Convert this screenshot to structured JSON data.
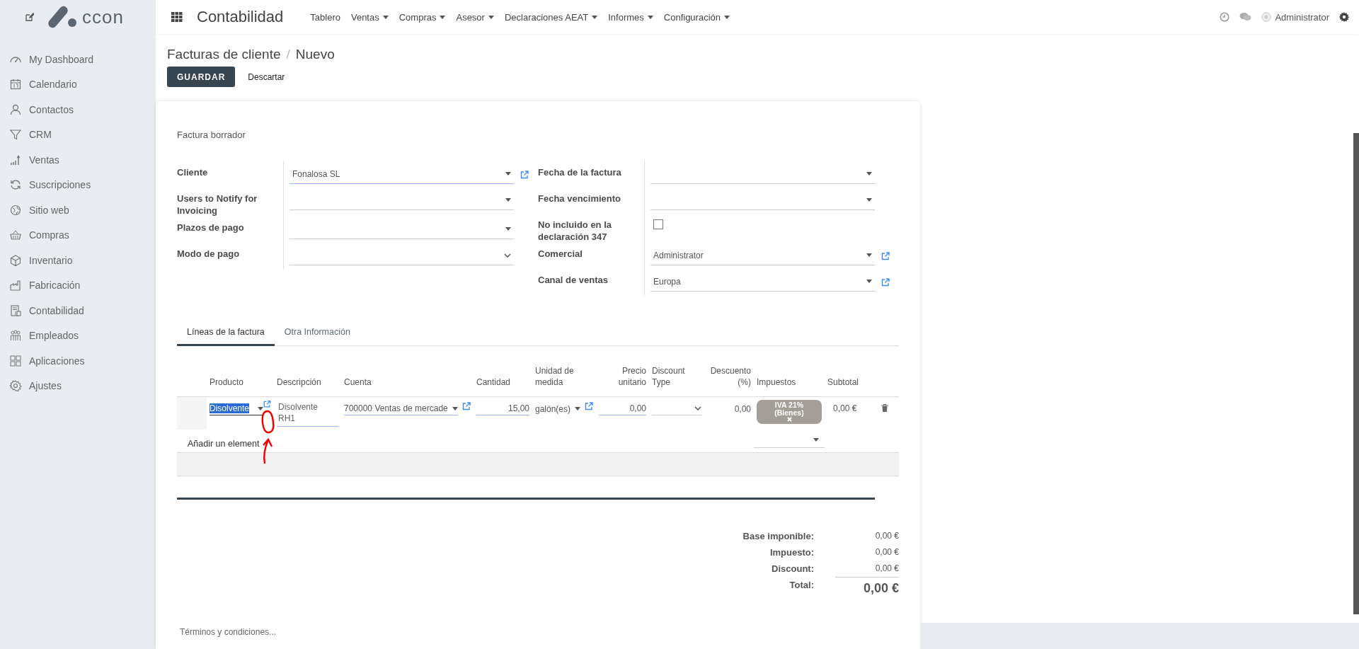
{
  "sidebar": {
    "logo_text": "ccon",
    "items": [
      {
        "label": "My Dashboard"
      },
      {
        "label": "Calendario"
      },
      {
        "label": "Contactos"
      },
      {
        "label": "CRM"
      },
      {
        "label": "Ventas"
      },
      {
        "label": "Suscripciones"
      },
      {
        "label": "Sitio web"
      },
      {
        "label": "Compras"
      },
      {
        "label": "Inventario"
      },
      {
        "label": "Fabricación"
      },
      {
        "label": "Contabilidad"
      },
      {
        "label": "Empleados"
      },
      {
        "label": "Aplicaciones"
      },
      {
        "label": "Ajustes"
      }
    ]
  },
  "topbar": {
    "app_title": "Contabilidad",
    "menus": [
      {
        "label": "Tablero",
        "dropdown": false
      },
      {
        "label": "Ventas",
        "dropdown": true
      },
      {
        "label": "Compras",
        "dropdown": true
      },
      {
        "label": "Asesor",
        "dropdown": true
      },
      {
        "label": "Declaraciones AEAT",
        "dropdown": true
      },
      {
        "label": "Informes",
        "dropdown": true
      },
      {
        "label": "Configuración",
        "dropdown": true
      }
    ],
    "user": "Administrator"
  },
  "breadcrumb": {
    "parent": "Facturas de cliente",
    "separator": "/",
    "current": "Nuevo"
  },
  "actions": {
    "save": "GUARDAR",
    "discard": "Descartar"
  },
  "form": {
    "status": "Factura borrador",
    "left_fields": [
      {
        "label": "Cliente",
        "kind": "select",
        "value": "Fonalosa SL",
        "link": true,
        "focused": true
      },
      {
        "label": "Users to Notify for Invoicing",
        "kind": "select",
        "link": false,
        "focused": false
      },
      {
        "label": "Plazos de pago",
        "kind": "select",
        "link": false,
        "focused": false
      },
      {
        "label": "Modo de pago",
        "kind": "chevron",
        "link": false,
        "focused": false
      }
    ],
    "right_fields": [
      {
        "label": "Fecha de la factura",
        "kind": "select",
        "link": false,
        "focused": false
      },
      {
        "label": "Fecha vencimiento",
        "kind": "select",
        "link": false,
        "focused": false
      },
      {
        "label": "No incluido en la declaración 347",
        "kind": "checkbox",
        "checked": false
      },
      {
        "label": "Comercial",
        "kind": "select",
        "value": "Administrator",
        "link": true,
        "focused": false
      },
      {
        "label": "Canal de ventas",
        "kind": "select",
        "value": "Europa",
        "link": true,
        "focused": false
      }
    ]
  },
  "tabs": [
    {
      "label": "Líneas de la factura",
      "selected": true
    },
    {
      "label": "Otra Información",
      "selected": false
    }
  ],
  "table": {
    "columns": [
      {
        "label": "Producto"
      },
      {
        "label": "Descripción"
      },
      {
        "label": "Cuenta"
      },
      {
        "label": "Cantidad"
      },
      {
        "label": "Unidad de medida"
      },
      {
        "label": "Precio unitario"
      },
      {
        "label": "Discount Type"
      },
      {
        "label": "Descuento (%)"
      },
      {
        "label": "Impuestos"
      },
      {
        "label": "Subtotal"
      }
    ],
    "rows": [
      {
        "product": "Disolvente",
        "product_text_selected": true,
        "description": "Disolvente RH1",
        "account": "700000 Ventas de mercade",
        "quantity": "15,00",
        "uom": "galón(es)",
        "unit_price": "0,00",
        "discount": "0,00",
        "tax": "IVA 21% (Bienes)",
        "subtotal": "0,00 €"
      }
    ],
    "add_line": "Añadir un element"
  },
  "totals": [
    {
      "label": "Base imponible:",
      "value": "0,00 €",
      "kind": "line"
    },
    {
      "label": "Impuesto:",
      "value": "0,00 €",
      "kind": "line"
    },
    {
      "label": "Discount:",
      "value": "0,00 €",
      "kind": "line"
    },
    {
      "label": "Total:",
      "value": "0,00 €",
      "kind": "total"
    }
  ],
  "terms": {
    "placeholder": "Términos y condiciones..."
  }
}
